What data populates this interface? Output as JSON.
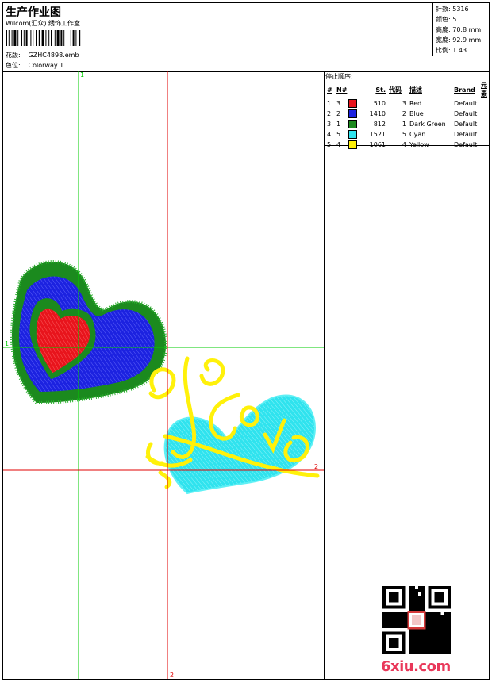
{
  "header": {
    "title": "生产作业图",
    "subtitle": "Wilcom(汇众) 绣饰工作室",
    "file_label": "花版:",
    "file_value": "GZHC4898.emb",
    "colorway_label": "色位:",
    "colorway_value": "Colorway 1"
  },
  "stats": {
    "stitches": "针数: 5316",
    "colors": "颜色: 5",
    "height": "高度: 70.8 mm",
    "width": "宽度: 92.9 mm",
    "scale": "比例: 1.43"
  },
  "stop_sequence": {
    "caption": "停止顺序:",
    "headers": [
      "#",
      "N#",
      "St.",
      "代码",
      "描述",
      "Brand",
      "元素"
    ],
    "rows": [
      {
        "n": "1.",
        "needle": "3",
        "color": "#e8141c",
        "st": "510",
        "code": "3",
        "desc": "Red",
        "brand": "Default"
      },
      {
        "n": "2.",
        "needle": "2",
        "color": "#1c22e0",
        "st": "1410",
        "code": "2",
        "desc": "Blue",
        "brand": "Default"
      },
      {
        "n": "3.",
        "needle": "1",
        "color": "#1b8a1e",
        "st": "812",
        "code": "1",
        "desc": "Dark Green",
        "brand": "Default"
      },
      {
        "n": "4.",
        "needle": "5",
        "color": "#2fe3ee",
        "st": "1521",
        "code": "5",
        "desc": "Cyan",
        "brand": "Default"
      },
      {
        "n": "5.",
        "needle": "4",
        "color": "#fff10a",
        "st": "1061",
        "code": "4",
        "desc": "Yellow",
        "brand": "Default"
      }
    ]
  },
  "design": {
    "marker_v1": "1",
    "marker_v2": "2",
    "marker_h1": "1",
    "marker_h2": "2",
    "text_lettering": "Love"
  },
  "watermark": "6xiu.com",
  "colors": {
    "guide_green": "#00cc00",
    "guide_red": "#e00000"
  }
}
